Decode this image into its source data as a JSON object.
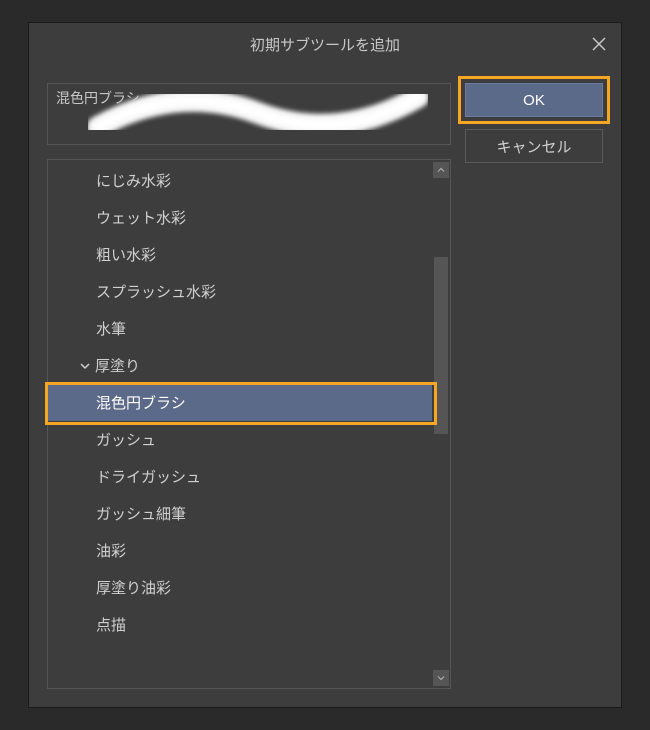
{
  "dialog": {
    "title": "初期サブツールを追加"
  },
  "preview": {
    "label": "混色円ブラシ"
  },
  "list": {
    "items": [
      {
        "label": "にじみ水彩",
        "indent": false,
        "group": false,
        "selected": false
      },
      {
        "label": "ウェット水彩",
        "indent": false,
        "group": false,
        "selected": false
      },
      {
        "label": "粗い水彩",
        "indent": false,
        "group": false,
        "selected": false
      },
      {
        "label": "スプラッシュ水彩",
        "indent": false,
        "group": false,
        "selected": false
      },
      {
        "label": "水筆",
        "indent": false,
        "group": false,
        "selected": false
      },
      {
        "label": "厚塗り",
        "indent": false,
        "group": true,
        "selected": false
      },
      {
        "label": "混色円ブラシ",
        "indent": false,
        "group": false,
        "selected": true
      },
      {
        "label": "ガッシュ",
        "indent": false,
        "group": false,
        "selected": false
      },
      {
        "label": "ドライガッシュ",
        "indent": false,
        "group": false,
        "selected": false
      },
      {
        "label": "ガッシュ細筆",
        "indent": false,
        "group": false,
        "selected": false
      },
      {
        "label": "油彩",
        "indent": false,
        "group": false,
        "selected": false
      },
      {
        "label": "厚塗り油彩",
        "indent": false,
        "group": false,
        "selected": false
      },
      {
        "label": "点描",
        "indent": false,
        "group": false,
        "selected": false
      }
    ]
  },
  "buttons": {
    "ok": "OK",
    "cancel": "キャンセル"
  }
}
